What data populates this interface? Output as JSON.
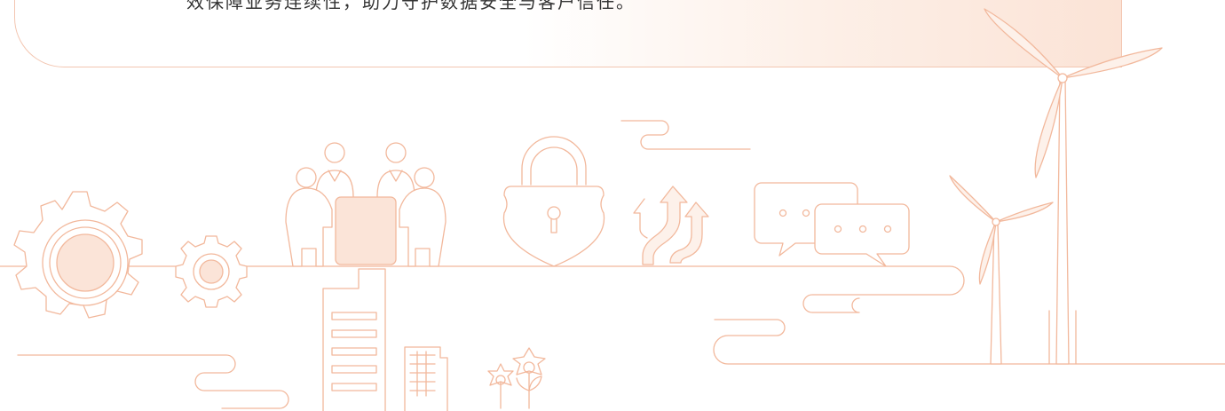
{
  "card": {
    "text": "效保障业务连续性，助力守护数据安全与客户信任。"
  },
  "colors": {
    "line": "#f2b89c",
    "fill": "#fbe4d8",
    "fill_light": "#fdf1ea"
  },
  "illustration": {
    "icons": [
      "gear-large-icon",
      "gear-small-icon",
      "meeting-people-icon",
      "padlock-icon",
      "growth-arrows-icon",
      "chat-bubbles-icon",
      "office-buildings-icon",
      "flowers-icon",
      "wind-turbine-large-icon",
      "wind-turbine-small-icon"
    ]
  }
}
